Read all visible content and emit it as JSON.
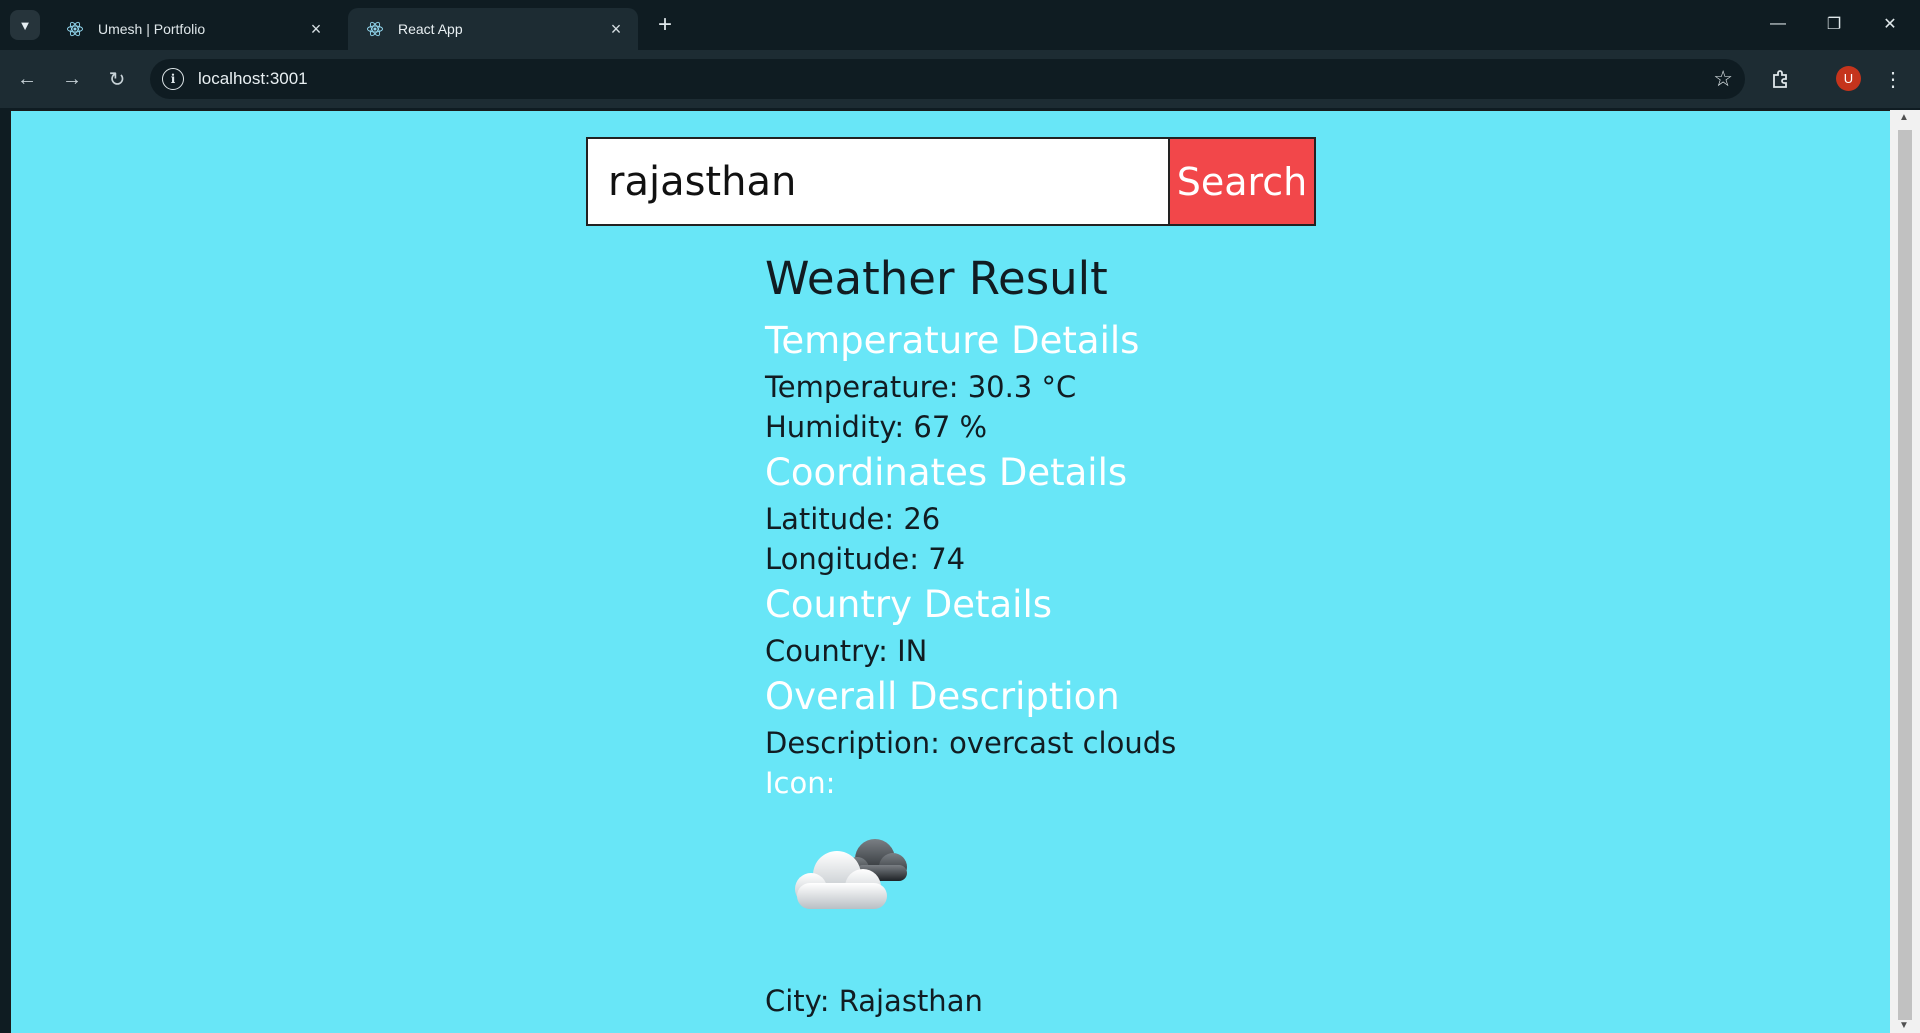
{
  "browser": {
    "tabs": [
      {
        "title": "Umesh | Portfolio",
        "active": false
      },
      {
        "title": "React App",
        "active": true
      }
    ],
    "url": "localhost:3001",
    "profile_initial": "U"
  },
  "app": {
    "search": {
      "value": "rajasthan",
      "button_label": "Search"
    },
    "result": {
      "heading": "Weather Result",
      "temperature_heading": "Temperature Details",
      "temperature": "Temperature: 30.3 °C",
      "humidity": "Humidity: 67 %",
      "coordinates_heading": "Coordinates Details",
      "latitude": "Latitude: 26",
      "longitude": "Longitude: 74",
      "country_heading": "Country Details",
      "country": "Country: IN",
      "description_heading": "Overall Description",
      "description": "Description: overcast clouds",
      "icon_label": "Icon:",
      "icon_name": "overcast-clouds-icon",
      "city": "City: Rajasthan"
    }
  },
  "colors": {
    "page_background": "#68e6f7",
    "search_button": "#f2474a",
    "section_heading": "#ffffff"
  }
}
